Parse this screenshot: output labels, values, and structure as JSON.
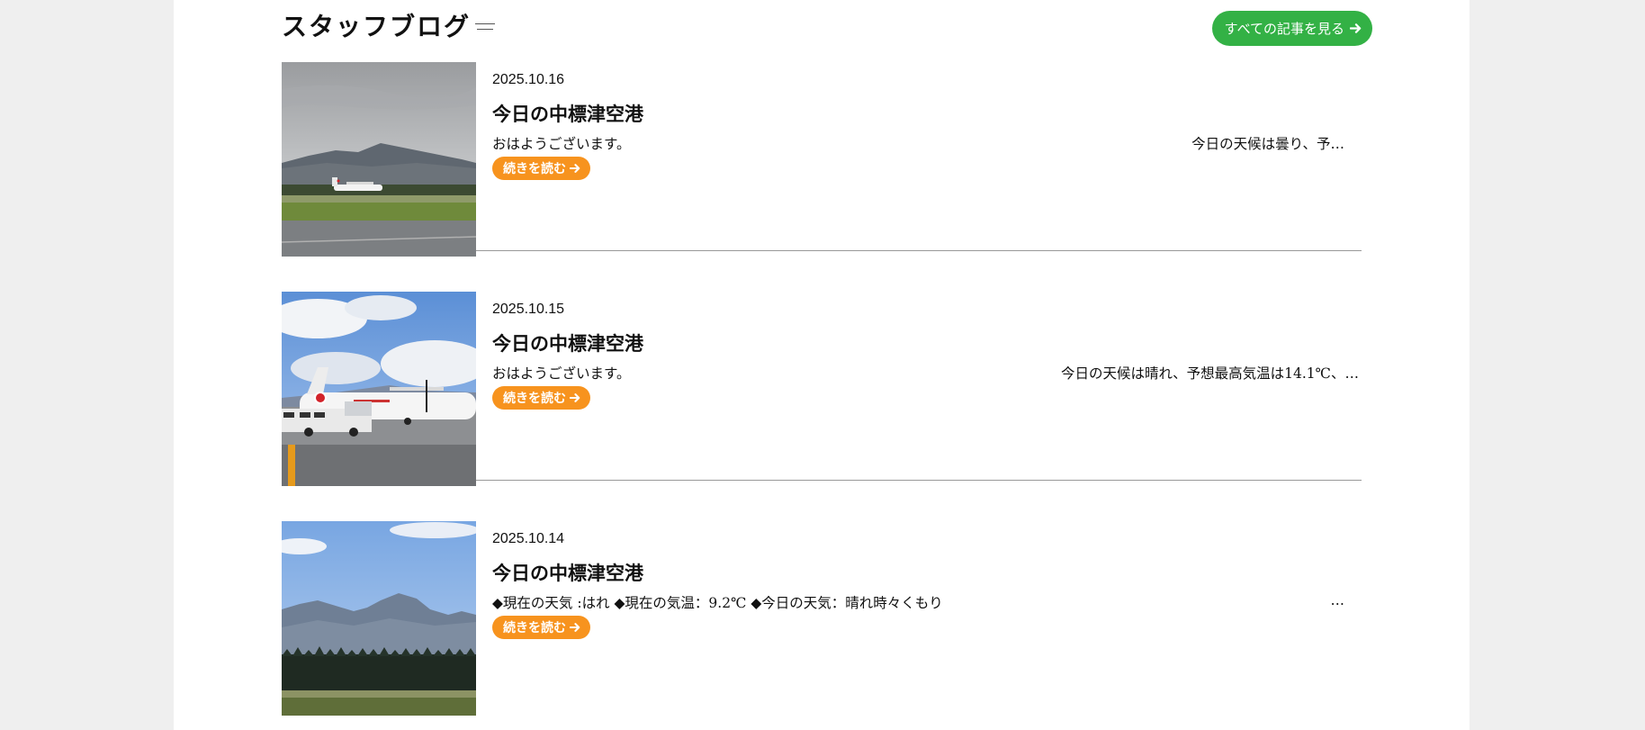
{
  "section": {
    "title": "スタッフブログ",
    "all_posts_label": "すべての記事を見る"
  },
  "posts": [
    {
      "date": "2025.10.16",
      "title": "今日の中標津空港",
      "excerpt_left": "おはようございます。",
      "excerpt_right": "今日の天候は曇り、予…",
      "read_more": "続きを読む"
    },
    {
      "date": "2025.10.15",
      "title": "今日の中標津空港",
      "excerpt_left": "おはようございます。",
      "excerpt_right": "今日の天候は晴れ、予想最高気温は14.1℃、…",
      "read_more": "続きを読む"
    },
    {
      "date": "2025.10.14",
      "title": "今日の中標津空港",
      "excerpt_left": "◆現在の天気 :はれ ◆現在の気温：9.2℃ ◆今日の天気：晴れ時々くもり",
      "excerpt_right": "…",
      "read_more": "続きを読む"
    }
  ],
  "colors": {
    "page_bg": "#efefef",
    "card_bg": "#ffffff",
    "all_posts_button": "#33b145",
    "read_more_button": "#f7931e",
    "divider": "#999999"
  },
  "icons": {
    "arrow": "arrow-right-icon"
  }
}
